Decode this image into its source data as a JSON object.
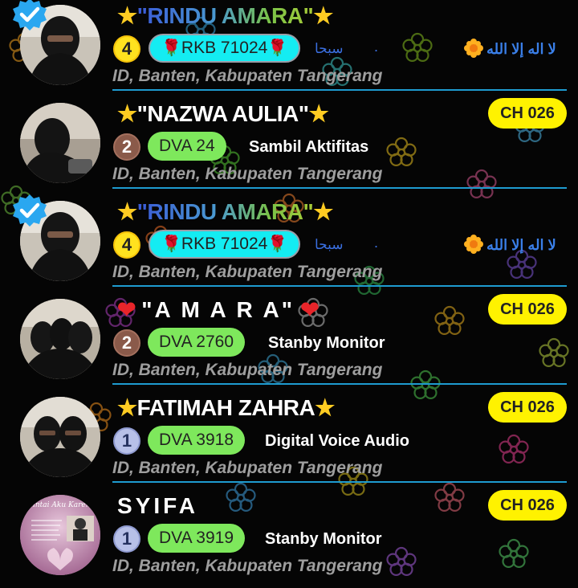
{
  "rows": [
    {
      "name": "\"RINDU AMARA\"",
      "name_style": "gradient",
      "deco_left": "★",
      "deco_right": "★",
      "verified": true,
      "level": "4",
      "badge_text": "RKB 71024",
      "badge_deco": "🌹",
      "arabic_left": "سبحا",
      "dot": ".",
      "arabic_right": "لا اله إلا الله",
      "location": "ID, Banten, Kabupaten Tangerang"
    },
    {
      "name": "\"NAZWA AULIA\"",
      "name_style": "white",
      "deco_left": "★",
      "deco_right": "★",
      "verified": false,
      "level": "2",
      "badge_text": "DVA 24",
      "status": "Sambil Aktifitas",
      "channel": "CH 026",
      "location": "ID, Banten, Kabupaten Tangerang"
    },
    {
      "name": "\"RINDU AMARA\"",
      "name_style": "gradient",
      "deco_left": "★",
      "deco_right": "★",
      "verified": true,
      "level": "4",
      "badge_text": "RKB 71024",
      "badge_deco": "🌹",
      "arabic_left": "سبحا",
      "dot": ".",
      "arabic_right": "لا اله إلا الله",
      "location": "ID, Banten, Kabupaten Tangerang"
    },
    {
      "name": "\"A M A R A\"",
      "name_style": "white",
      "deco_left": "❤",
      "deco_right": "❤",
      "verified": false,
      "level": "2",
      "badge_text": "DVA 2760",
      "status": "Stanby Monitor",
      "channel": "CH 026",
      "location": "ID, Banten, Kabupaten Tangerang"
    },
    {
      "name": "FATIMAH ZAHRA",
      "name_style": "white",
      "deco_left": "★",
      "deco_right": "★",
      "verified": false,
      "level": "1",
      "badge_text": "DVA 3918",
      "status": "Digital Voice Audio",
      "channel": "CH 026",
      "location": "ID, Banten, Kabupaten Tangerang"
    },
    {
      "name": "SYIFA",
      "name_style": "spaced",
      "verified": false,
      "level": "1",
      "badge_text": "DVA 3919",
      "status": "Stanby Monitor",
      "channel": "CH 026",
      "location": "ID, Banten, Kabupaten Tangerang",
      "avatar_text": "Cintai Aku Karena"
    }
  ],
  "icons": {
    "verified": "verified-check-icon",
    "star": "star-icon",
    "heart": "heart-icon",
    "rose": "rose-icon",
    "flower": "sunflower-icon"
  },
  "colors": {
    "background": "#050505",
    "divider": "#1e9bcf",
    "channel_badge": "#fff200",
    "green_badge": "#7ee85c",
    "cyan_badge": "#14ecf2",
    "location_text": "#9e9e9e",
    "level_4": "#ffe21f",
    "level_2": "#8a5a4a",
    "level_1": "#b7c0e8"
  }
}
